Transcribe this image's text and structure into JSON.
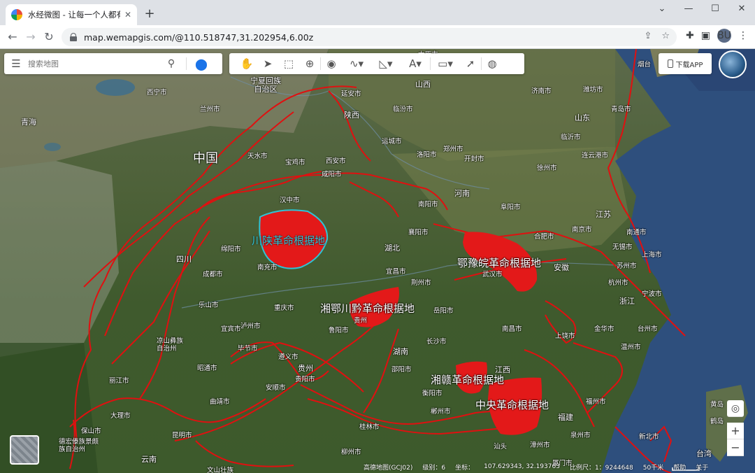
{
  "browser": {
    "tab_title": "水经微图 - 让每一个人都有自己",
    "url": "map.wemapgis.com/@110.518747,31.202954,6.00z",
    "profile_initials": "BU"
  },
  "search": {
    "placeholder": "搜索地图"
  },
  "download_label": "下载APP",
  "status": {
    "provider": "高德地图(GCJ02)",
    "level": "级别：6",
    "coords_label": "坐标：",
    "coords": "107.629343, 32.193763",
    "scale": "比例尺：1：9244648",
    "scale_bar": "50千米",
    "help": "帮助",
    "about": "关于"
  },
  "map": {
    "country": "中国",
    "base_areas": {
      "chuanshaan": "川陕革命根据地",
      "eyuwan": "鄂豫皖革命根据地",
      "xiangechuanqian": "湘鄂川黔革命根据地",
      "xianggan": "湘赣革命根据地",
      "central": "中央革命根据地"
    },
    "provinces": [
      "青海",
      "宁夏回族自治区",
      "山西",
      "陕西",
      "河南",
      "山东",
      "江苏",
      "安徽",
      "湖北",
      "四川",
      "湖南",
      "浙江",
      "江西",
      "福建",
      "贵州",
      "云南",
      "台湾"
    ],
    "cities": [
      "西宁市",
      "兰州市",
      "天水市",
      "宝鸡市",
      "西安市",
      "咸阳市",
      "延安市",
      "临汾市",
      "太原市",
      "运城市",
      "郑州市",
      "洛阳市",
      "开封市",
      "南阳市",
      "阜阳市",
      "徐州市",
      "济南市",
      "潍坊市",
      "青岛市",
      "临沂市",
      "连云港市",
      "合肥市",
      "南京市",
      "南通市",
      "无锡市",
      "上海市",
      "苏州市",
      "杭州市",
      "宁波市",
      "金华市",
      "台州市",
      "温州市",
      "汉中市",
      "襄阳市",
      "宜昌市",
      "荆州市",
      "武汉市",
      "岳阳市",
      "长沙市",
      "南昌市",
      "上饶市",
      "福州市",
      "泉州市",
      "厦门市",
      "漳州市",
      "绵阳市",
      "南充市",
      "成都市",
      "乐山市",
      "重庆市",
      "宜宾市",
      "泸州市",
      "遵义市",
      "贵州",
      "毕节市",
      "昭通市",
      "丽江市",
      "大理市",
      "昆明市",
      "曲靖市",
      "安顺市",
      "贵阳市",
      "邵阳市",
      "衡阳市",
      "郴州市",
      "桂林市",
      "柳州市",
      "保山市",
      "德宏傣族景颇族自治州",
      "文山壮族",
      "凉山彝族自治州",
      "烟台",
      "黄岛",
      "鹤岛",
      "新北市",
      "鲁阳市",
      "汕头"
    ],
    "island": "黄岛"
  }
}
